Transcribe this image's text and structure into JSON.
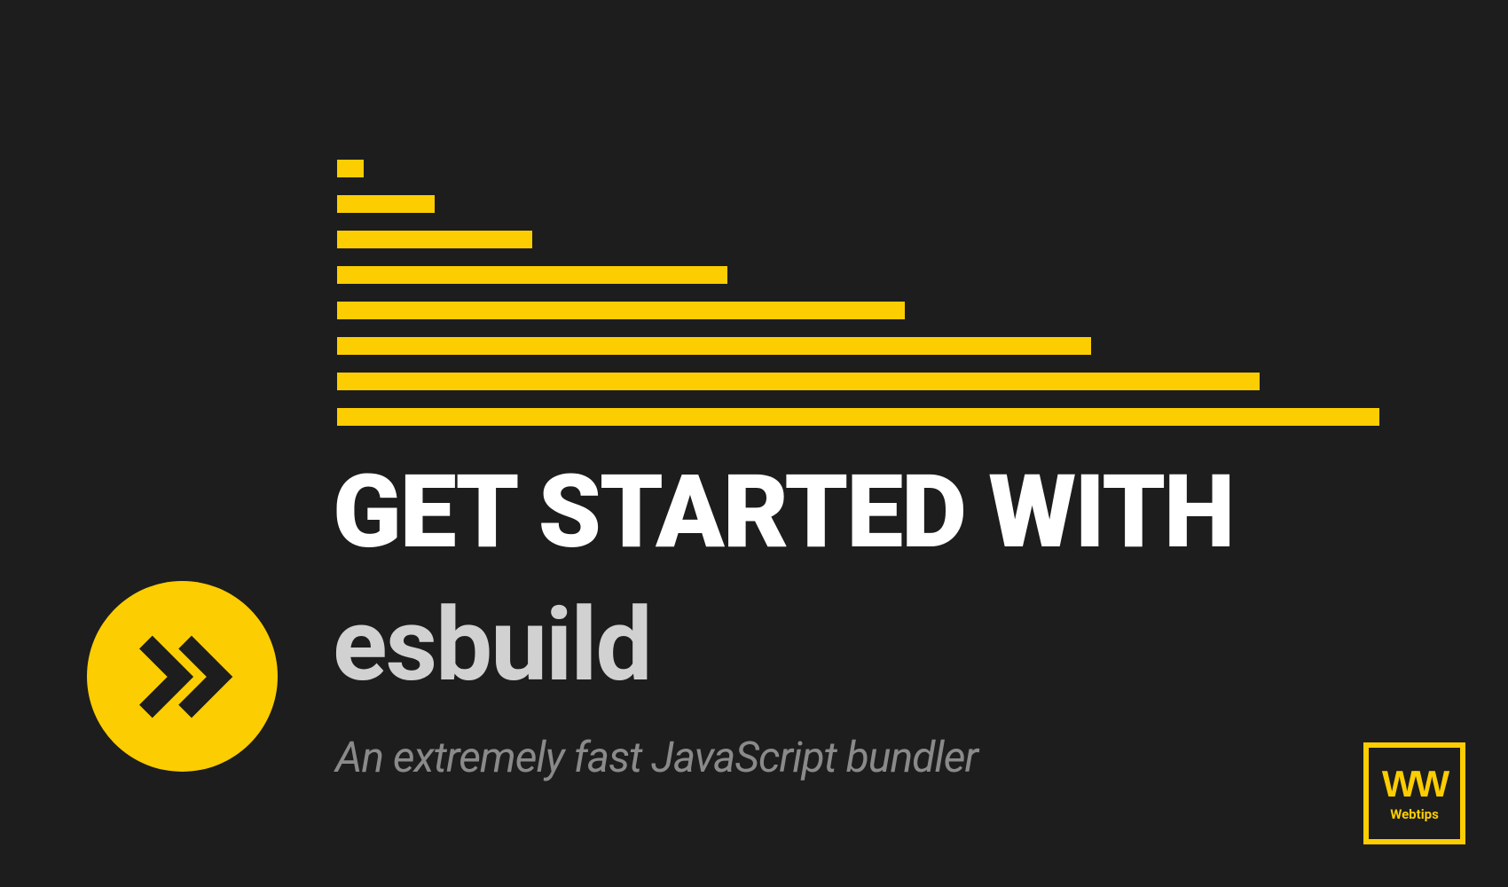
{
  "headline": "GET STARTED WITH",
  "subhead": "esbuild",
  "tagline": "An extremely fast JavaScript bundler",
  "logo": {
    "mark": "WW",
    "label": "Webtips"
  },
  "colors": {
    "accent": "#fccd00",
    "background": "#1d1d1d",
    "text_primary": "#ffffff",
    "text_secondary": "#d1d1d1",
    "text_muted": "#8a8a8a"
  },
  "chart_data": {
    "type": "bar",
    "orientation": "horizontal",
    "bars": [
      30,
      110,
      220,
      440,
      640,
      850,
      1040,
      1175
    ]
  }
}
